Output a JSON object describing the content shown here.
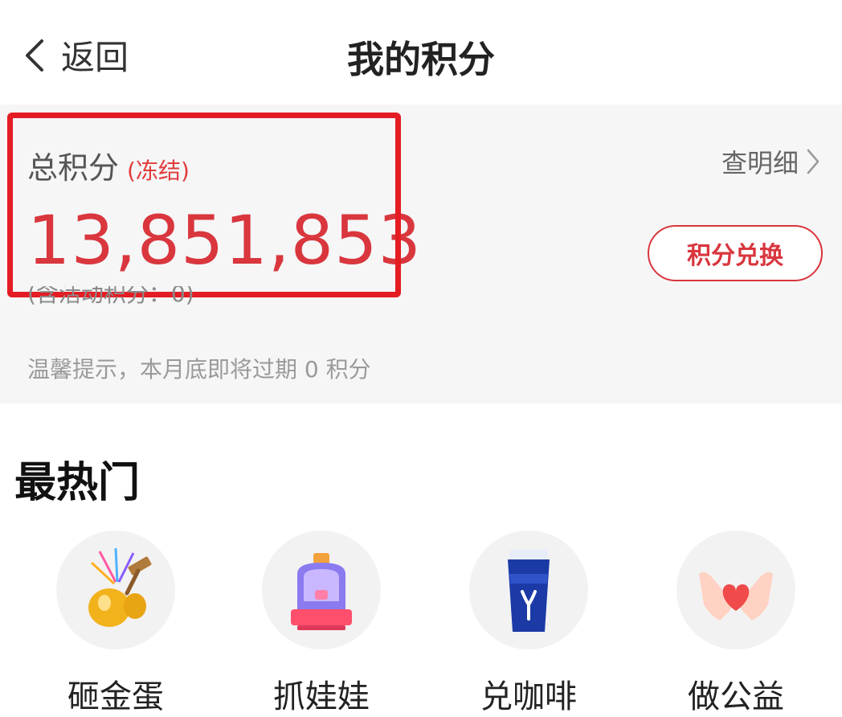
{
  "header": {
    "back_label": "返回",
    "title": "我的积分"
  },
  "points_card": {
    "label": "总积分",
    "frozen_label": "(冻结)",
    "total_points": "13,851,853",
    "detail_link": "查明细",
    "exchange_button": "积分兑换",
    "activity_points_text": "(含活动积分：0)",
    "tip_text": "温馨提示，本月底即将过期 0 积分",
    "accent_color": "#d9363e",
    "highlight_box_color": "#e41c23"
  },
  "hot_section": {
    "title": "最热门",
    "items": [
      {
        "label": "砸金蛋",
        "icon": "golden-egg-hammer-icon"
      },
      {
        "label": "抓娃娃",
        "icon": "claw-machine-icon"
      },
      {
        "label": "兑咖啡",
        "icon": "coffee-cup-icon"
      },
      {
        "label": "做公益",
        "icon": "heart-hands-icon"
      }
    ]
  }
}
